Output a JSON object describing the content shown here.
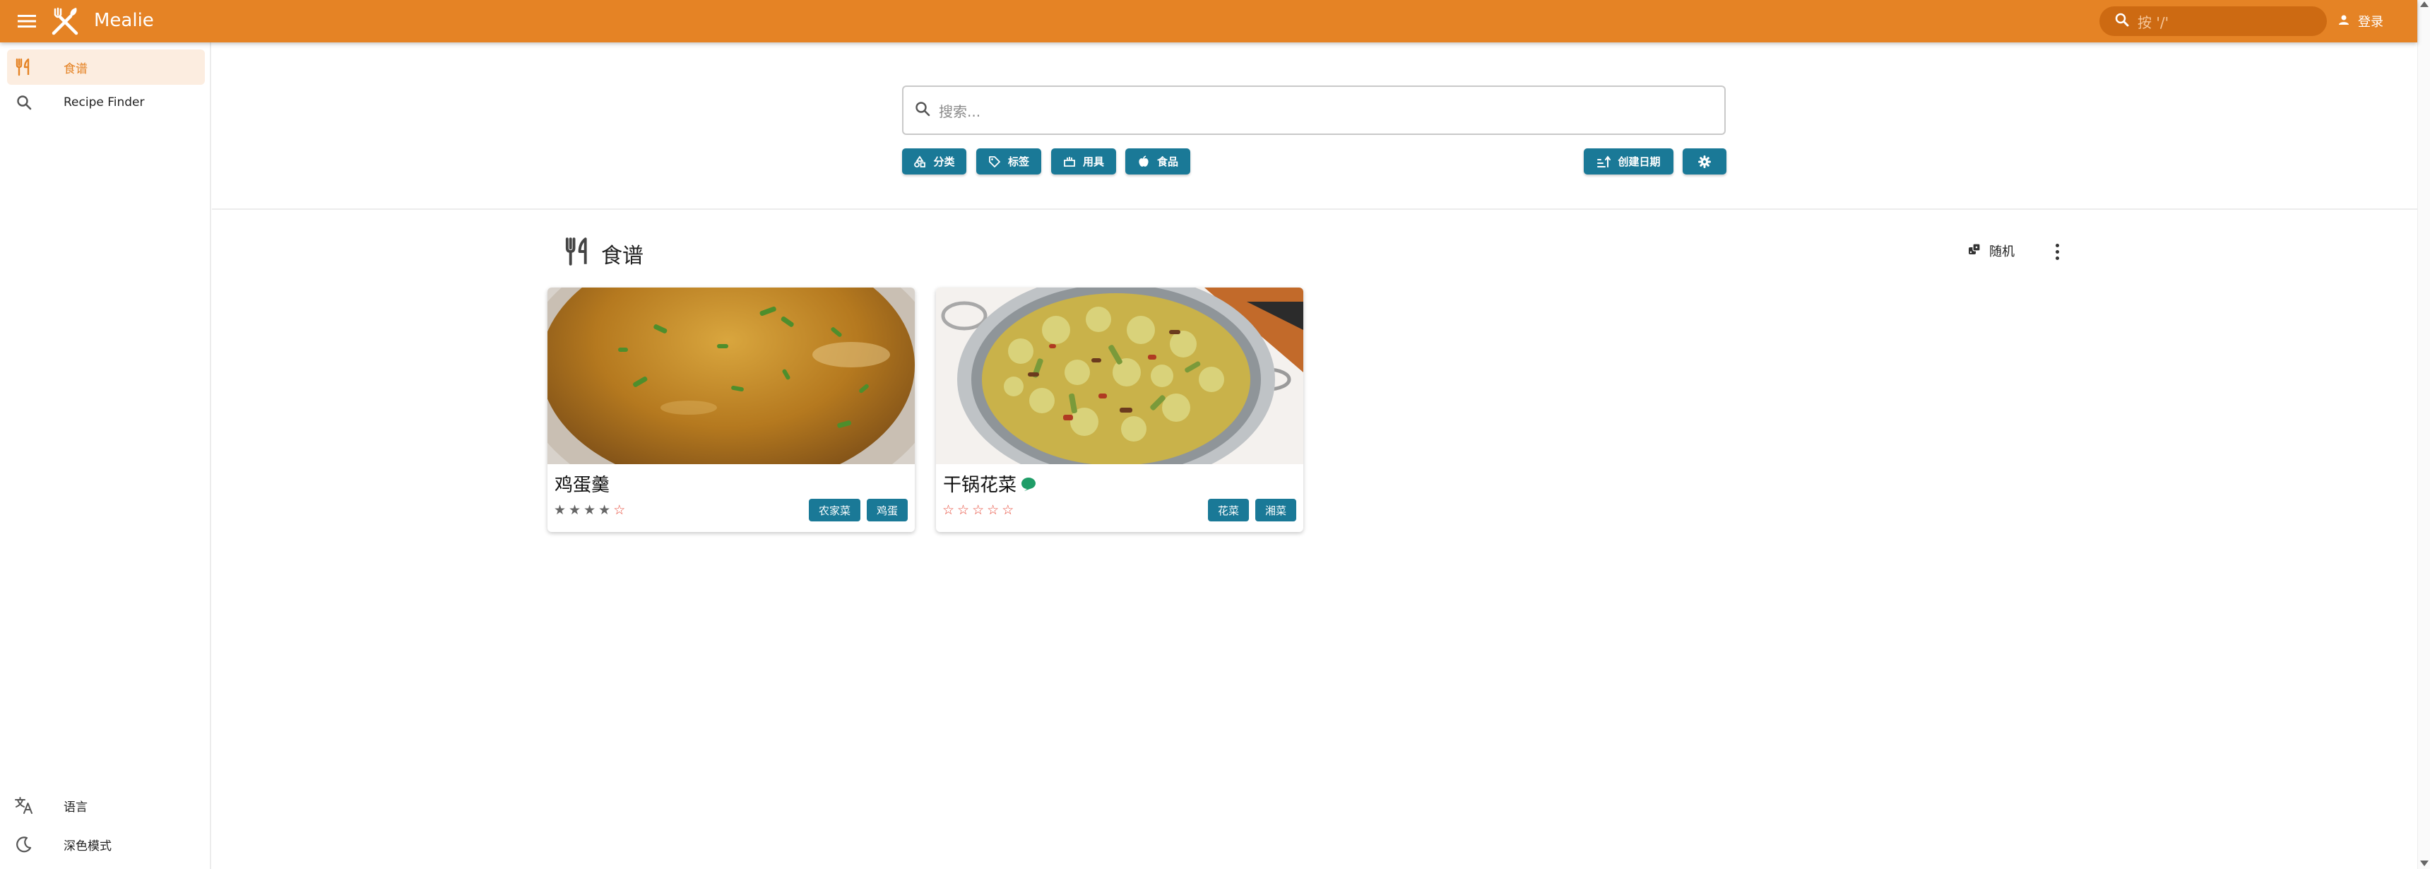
{
  "app": {
    "title": "Mealie",
    "search_placeholder": "按 '/'",
    "login_label": "登录",
    "accent_color": "#E58325",
    "button_color": "#1A7997"
  },
  "sidebar": {
    "items": [
      {
        "label": "食谱",
        "icon": "fork-knife-icon",
        "active": true
      },
      {
        "label": "Recipe Finder",
        "icon": "search-icon",
        "active": false
      }
    ],
    "bottom_items": [
      {
        "label": "语言",
        "icon": "translate-icon"
      },
      {
        "label": "深色模式",
        "icon": "dark-mode-icon"
      }
    ]
  },
  "search": {
    "placeholder": "搜索..."
  },
  "filters": {
    "categories_label": "分类",
    "tags_label": "标签",
    "tools_label": "用具",
    "foods_label": "食品",
    "sort_label": "创建日期"
  },
  "section": {
    "title": "食谱",
    "random_label": "随机"
  },
  "recipes": [
    {
      "name": "鸡蛋羹",
      "rating": 4,
      "max_rating": 5,
      "tags": [
        "农家菜",
        "鸡蛋"
      ]
    },
    {
      "name": "干锅花菜",
      "rating": 0,
      "max_rating": 5,
      "tags": [
        "花菜",
        "湘菜"
      ],
      "has_comment": true
    }
  ]
}
